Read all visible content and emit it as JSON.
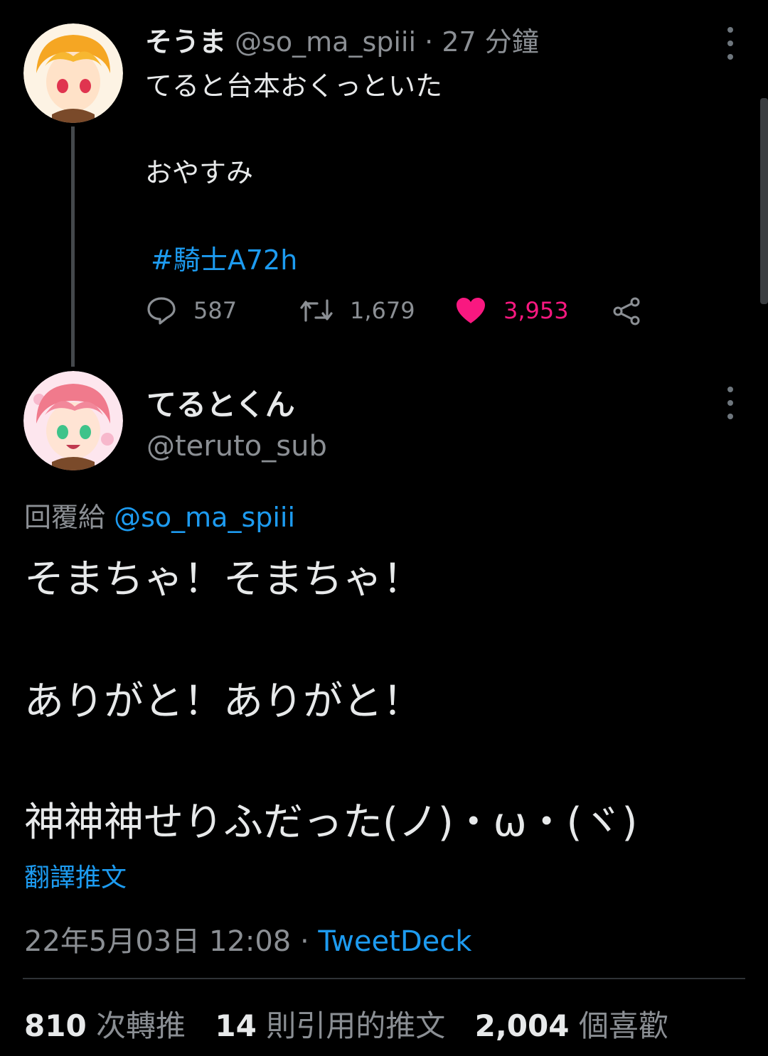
{
  "tweet1": {
    "display_name": "そうま",
    "handle": "@so_ma_spiii",
    "separator": "·",
    "time_ago": "27 分鐘",
    "lines": [
      "てると台本おくっといた",
      "おやすみ"
    ],
    "hashtag": "#騎士A72h",
    "actions": {
      "replies": "587",
      "retweets": "1,679",
      "likes": "3,953"
    }
  },
  "tweet2": {
    "display_name": "てるとくん",
    "handle": "@teruto_sub",
    "reply_prefix": "回覆給",
    "reply_to": "@so_ma_spiii",
    "lines": [
      "そまちゃ！そまちゃ！",
      "ありがと！ありがと！",
      "神神神せりふだった(ノ)・ω・(ヾ)"
    ],
    "translate_label": "翻譯推文",
    "timestamp": "22年5月03日 12:08",
    "separator": "·",
    "source": "TweetDeck",
    "stats": {
      "retweets_count": "810",
      "retweets_label": "次轉推",
      "quotes_count": "14",
      "quotes_label": "則引用的推文",
      "likes_count": "2,004",
      "likes_label": "個喜歡"
    }
  },
  "icons": [
    "reply-icon",
    "retweet-icon",
    "heart-icon",
    "share-icon",
    "more-icon"
  ],
  "colors": {
    "background": "#000000",
    "link": "#1d9bf0",
    "like": "#f91880",
    "muted": "#8b8f94"
  }
}
